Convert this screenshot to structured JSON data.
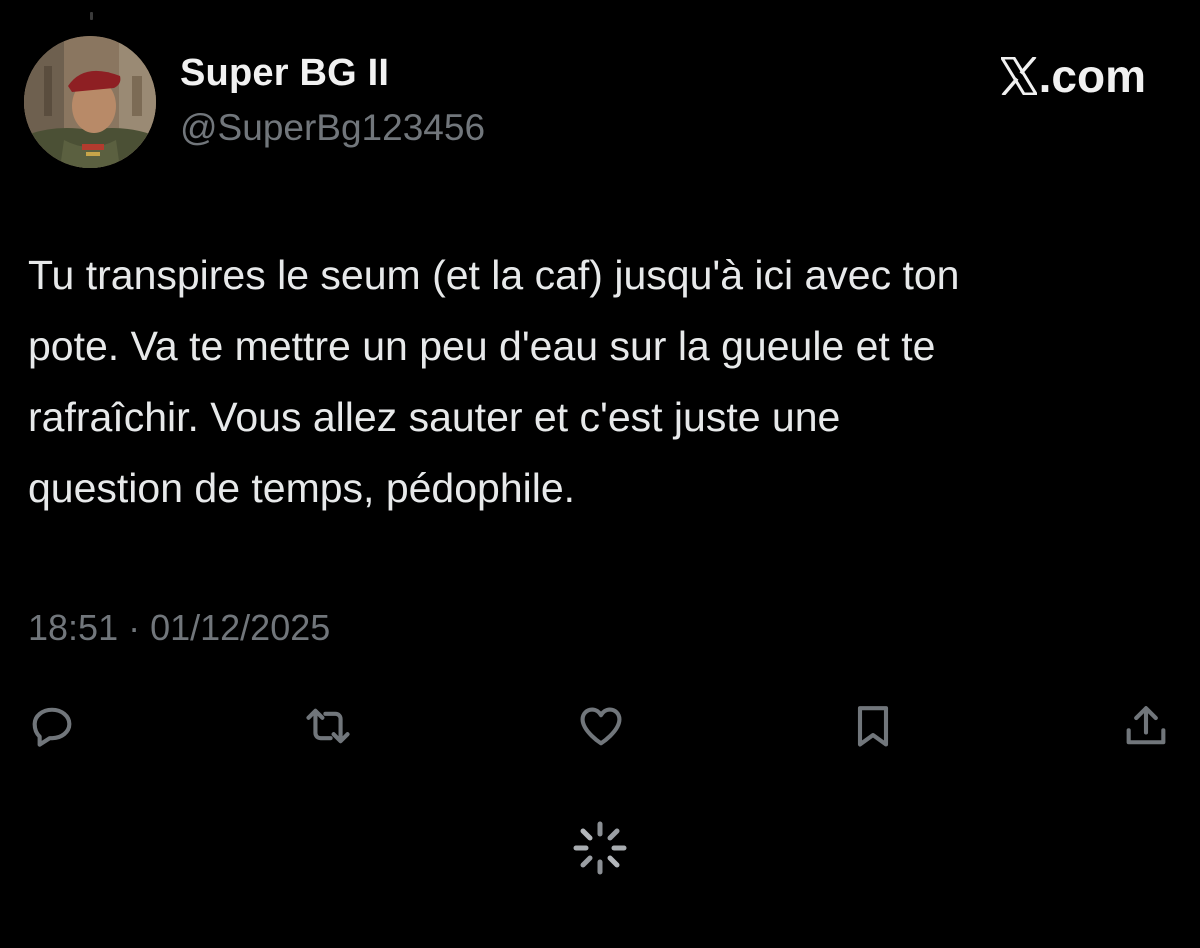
{
  "author": {
    "display_name": "Super BG II",
    "handle": "@SuperBg123456"
  },
  "brand": {
    "suffix": ".com"
  },
  "tweet": {
    "text": "Tu transpires le seum (et la caf) jusqu'à ici avec ton\npote. Va te mettre un peu d'eau sur la gueule et te\nrafraîchir. Vous allez sauter et c'est juste une\nquestion de temps, pédophile.",
    "timestamp": "18:51 · 01/12/2025"
  },
  "actions": [
    {
      "name": "reply",
      "icon": "reply-icon"
    },
    {
      "name": "repost",
      "icon": "repost-icon"
    },
    {
      "name": "like",
      "icon": "heart-icon"
    },
    {
      "name": "bookmark",
      "icon": "bookmark-icon"
    },
    {
      "name": "share",
      "icon": "share-icon"
    }
  ],
  "colors": {
    "background": "#000000",
    "primary_text": "#e7e9ea",
    "secondary_text": "#71767b",
    "icon": "#71767b"
  }
}
